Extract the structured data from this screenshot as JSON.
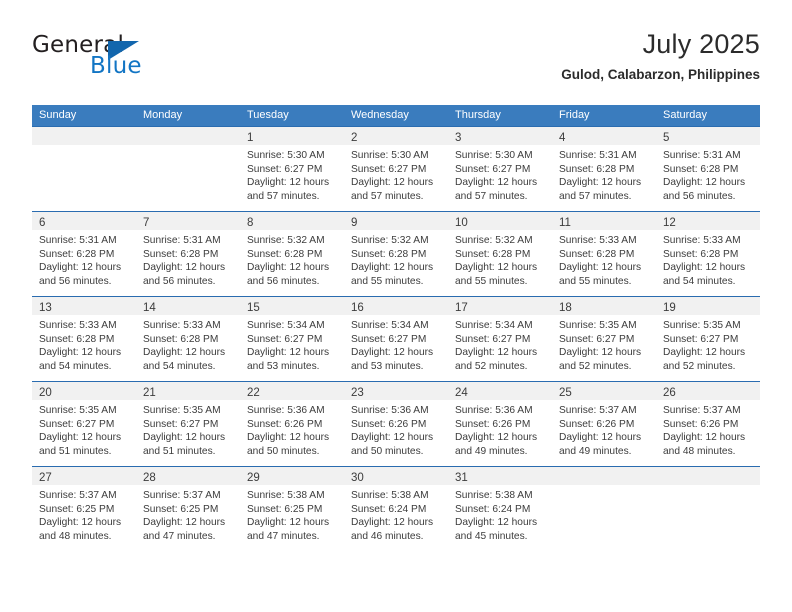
{
  "logo": {
    "word_one": "General",
    "word_two": "Blue",
    "triangle_icon": "triangle-icon",
    "brand_blue": "#1275c4",
    "brand_dark": "#231f20"
  },
  "header": {
    "title": "July 2025",
    "location": "Gulod, Calabarzon, Philippines"
  },
  "theme": {
    "header_bg": "#3a7cbe",
    "row_border": "#2a6cb0",
    "daynum_band_bg": "#f1f1f1",
    "text": "#3c3c3c"
  },
  "calendar": {
    "weekday_headers": [
      "Sunday",
      "Monday",
      "Tuesday",
      "Wednesday",
      "Thursday",
      "Friday",
      "Saturday"
    ],
    "weeks": [
      [
        {
          "day": "",
          "lines": []
        },
        {
          "day": "",
          "lines": []
        },
        {
          "day": "1",
          "lines": [
            "Sunrise: 5:30 AM",
            "Sunset: 6:27 PM",
            "Daylight: 12 hours",
            "and 57 minutes."
          ]
        },
        {
          "day": "2",
          "lines": [
            "Sunrise: 5:30 AM",
            "Sunset: 6:27 PM",
            "Daylight: 12 hours",
            "and 57 minutes."
          ]
        },
        {
          "day": "3",
          "lines": [
            "Sunrise: 5:30 AM",
            "Sunset: 6:27 PM",
            "Daylight: 12 hours",
            "and 57 minutes."
          ]
        },
        {
          "day": "4",
          "lines": [
            "Sunrise: 5:31 AM",
            "Sunset: 6:28 PM",
            "Daylight: 12 hours",
            "and 57 minutes."
          ]
        },
        {
          "day": "5",
          "lines": [
            "Sunrise: 5:31 AM",
            "Sunset: 6:28 PM",
            "Daylight: 12 hours",
            "and 56 minutes."
          ]
        }
      ],
      [
        {
          "day": "6",
          "lines": [
            "Sunrise: 5:31 AM",
            "Sunset: 6:28 PM",
            "Daylight: 12 hours",
            "and 56 minutes."
          ]
        },
        {
          "day": "7",
          "lines": [
            "Sunrise: 5:31 AM",
            "Sunset: 6:28 PM",
            "Daylight: 12 hours",
            "and 56 minutes."
          ]
        },
        {
          "day": "8",
          "lines": [
            "Sunrise: 5:32 AM",
            "Sunset: 6:28 PM",
            "Daylight: 12 hours",
            "and 56 minutes."
          ]
        },
        {
          "day": "9",
          "lines": [
            "Sunrise: 5:32 AM",
            "Sunset: 6:28 PM",
            "Daylight: 12 hours",
            "and 55 minutes."
          ]
        },
        {
          "day": "10",
          "lines": [
            "Sunrise: 5:32 AM",
            "Sunset: 6:28 PM",
            "Daylight: 12 hours",
            "and 55 minutes."
          ]
        },
        {
          "day": "11",
          "lines": [
            "Sunrise: 5:33 AM",
            "Sunset: 6:28 PM",
            "Daylight: 12 hours",
            "and 55 minutes."
          ]
        },
        {
          "day": "12",
          "lines": [
            "Sunrise: 5:33 AM",
            "Sunset: 6:28 PM",
            "Daylight: 12 hours",
            "and 54 minutes."
          ]
        }
      ],
      [
        {
          "day": "13",
          "lines": [
            "Sunrise: 5:33 AM",
            "Sunset: 6:28 PM",
            "Daylight: 12 hours",
            "and 54 minutes."
          ]
        },
        {
          "day": "14",
          "lines": [
            "Sunrise: 5:33 AM",
            "Sunset: 6:28 PM",
            "Daylight: 12 hours",
            "and 54 minutes."
          ]
        },
        {
          "day": "15",
          "lines": [
            "Sunrise: 5:34 AM",
            "Sunset: 6:27 PM",
            "Daylight: 12 hours",
            "and 53 minutes."
          ]
        },
        {
          "day": "16",
          "lines": [
            "Sunrise: 5:34 AM",
            "Sunset: 6:27 PM",
            "Daylight: 12 hours",
            "and 53 minutes."
          ]
        },
        {
          "day": "17",
          "lines": [
            "Sunrise: 5:34 AM",
            "Sunset: 6:27 PM",
            "Daylight: 12 hours",
            "and 52 minutes."
          ]
        },
        {
          "day": "18",
          "lines": [
            "Sunrise: 5:35 AM",
            "Sunset: 6:27 PM",
            "Daylight: 12 hours",
            "and 52 minutes."
          ]
        },
        {
          "day": "19",
          "lines": [
            "Sunrise: 5:35 AM",
            "Sunset: 6:27 PM",
            "Daylight: 12 hours",
            "and 52 minutes."
          ]
        }
      ],
      [
        {
          "day": "20",
          "lines": [
            "Sunrise: 5:35 AM",
            "Sunset: 6:27 PM",
            "Daylight: 12 hours",
            "and 51 minutes."
          ]
        },
        {
          "day": "21",
          "lines": [
            "Sunrise: 5:35 AM",
            "Sunset: 6:27 PM",
            "Daylight: 12 hours",
            "and 51 minutes."
          ]
        },
        {
          "day": "22",
          "lines": [
            "Sunrise: 5:36 AM",
            "Sunset: 6:26 PM",
            "Daylight: 12 hours",
            "and 50 minutes."
          ]
        },
        {
          "day": "23",
          "lines": [
            "Sunrise: 5:36 AM",
            "Sunset: 6:26 PM",
            "Daylight: 12 hours",
            "and 50 minutes."
          ]
        },
        {
          "day": "24",
          "lines": [
            "Sunrise: 5:36 AM",
            "Sunset: 6:26 PM",
            "Daylight: 12 hours",
            "and 49 minutes."
          ]
        },
        {
          "day": "25",
          "lines": [
            "Sunrise: 5:37 AM",
            "Sunset: 6:26 PM",
            "Daylight: 12 hours",
            "and 49 minutes."
          ]
        },
        {
          "day": "26",
          "lines": [
            "Sunrise: 5:37 AM",
            "Sunset: 6:26 PM",
            "Daylight: 12 hours",
            "and 48 minutes."
          ]
        }
      ],
      [
        {
          "day": "27",
          "lines": [
            "Sunrise: 5:37 AM",
            "Sunset: 6:25 PM",
            "Daylight: 12 hours",
            "and 48 minutes."
          ]
        },
        {
          "day": "28",
          "lines": [
            "Sunrise: 5:37 AM",
            "Sunset: 6:25 PM",
            "Daylight: 12 hours",
            "and 47 minutes."
          ]
        },
        {
          "day": "29",
          "lines": [
            "Sunrise: 5:38 AM",
            "Sunset: 6:25 PM",
            "Daylight: 12 hours",
            "and 47 minutes."
          ]
        },
        {
          "day": "30",
          "lines": [
            "Sunrise: 5:38 AM",
            "Sunset: 6:24 PM",
            "Daylight: 12 hours",
            "and 46 minutes."
          ]
        },
        {
          "day": "31",
          "lines": [
            "Sunrise: 5:38 AM",
            "Sunset: 6:24 PM",
            "Daylight: 12 hours",
            "and 45 minutes."
          ]
        },
        {
          "day": "",
          "lines": []
        },
        {
          "day": "",
          "lines": []
        }
      ]
    ]
  }
}
